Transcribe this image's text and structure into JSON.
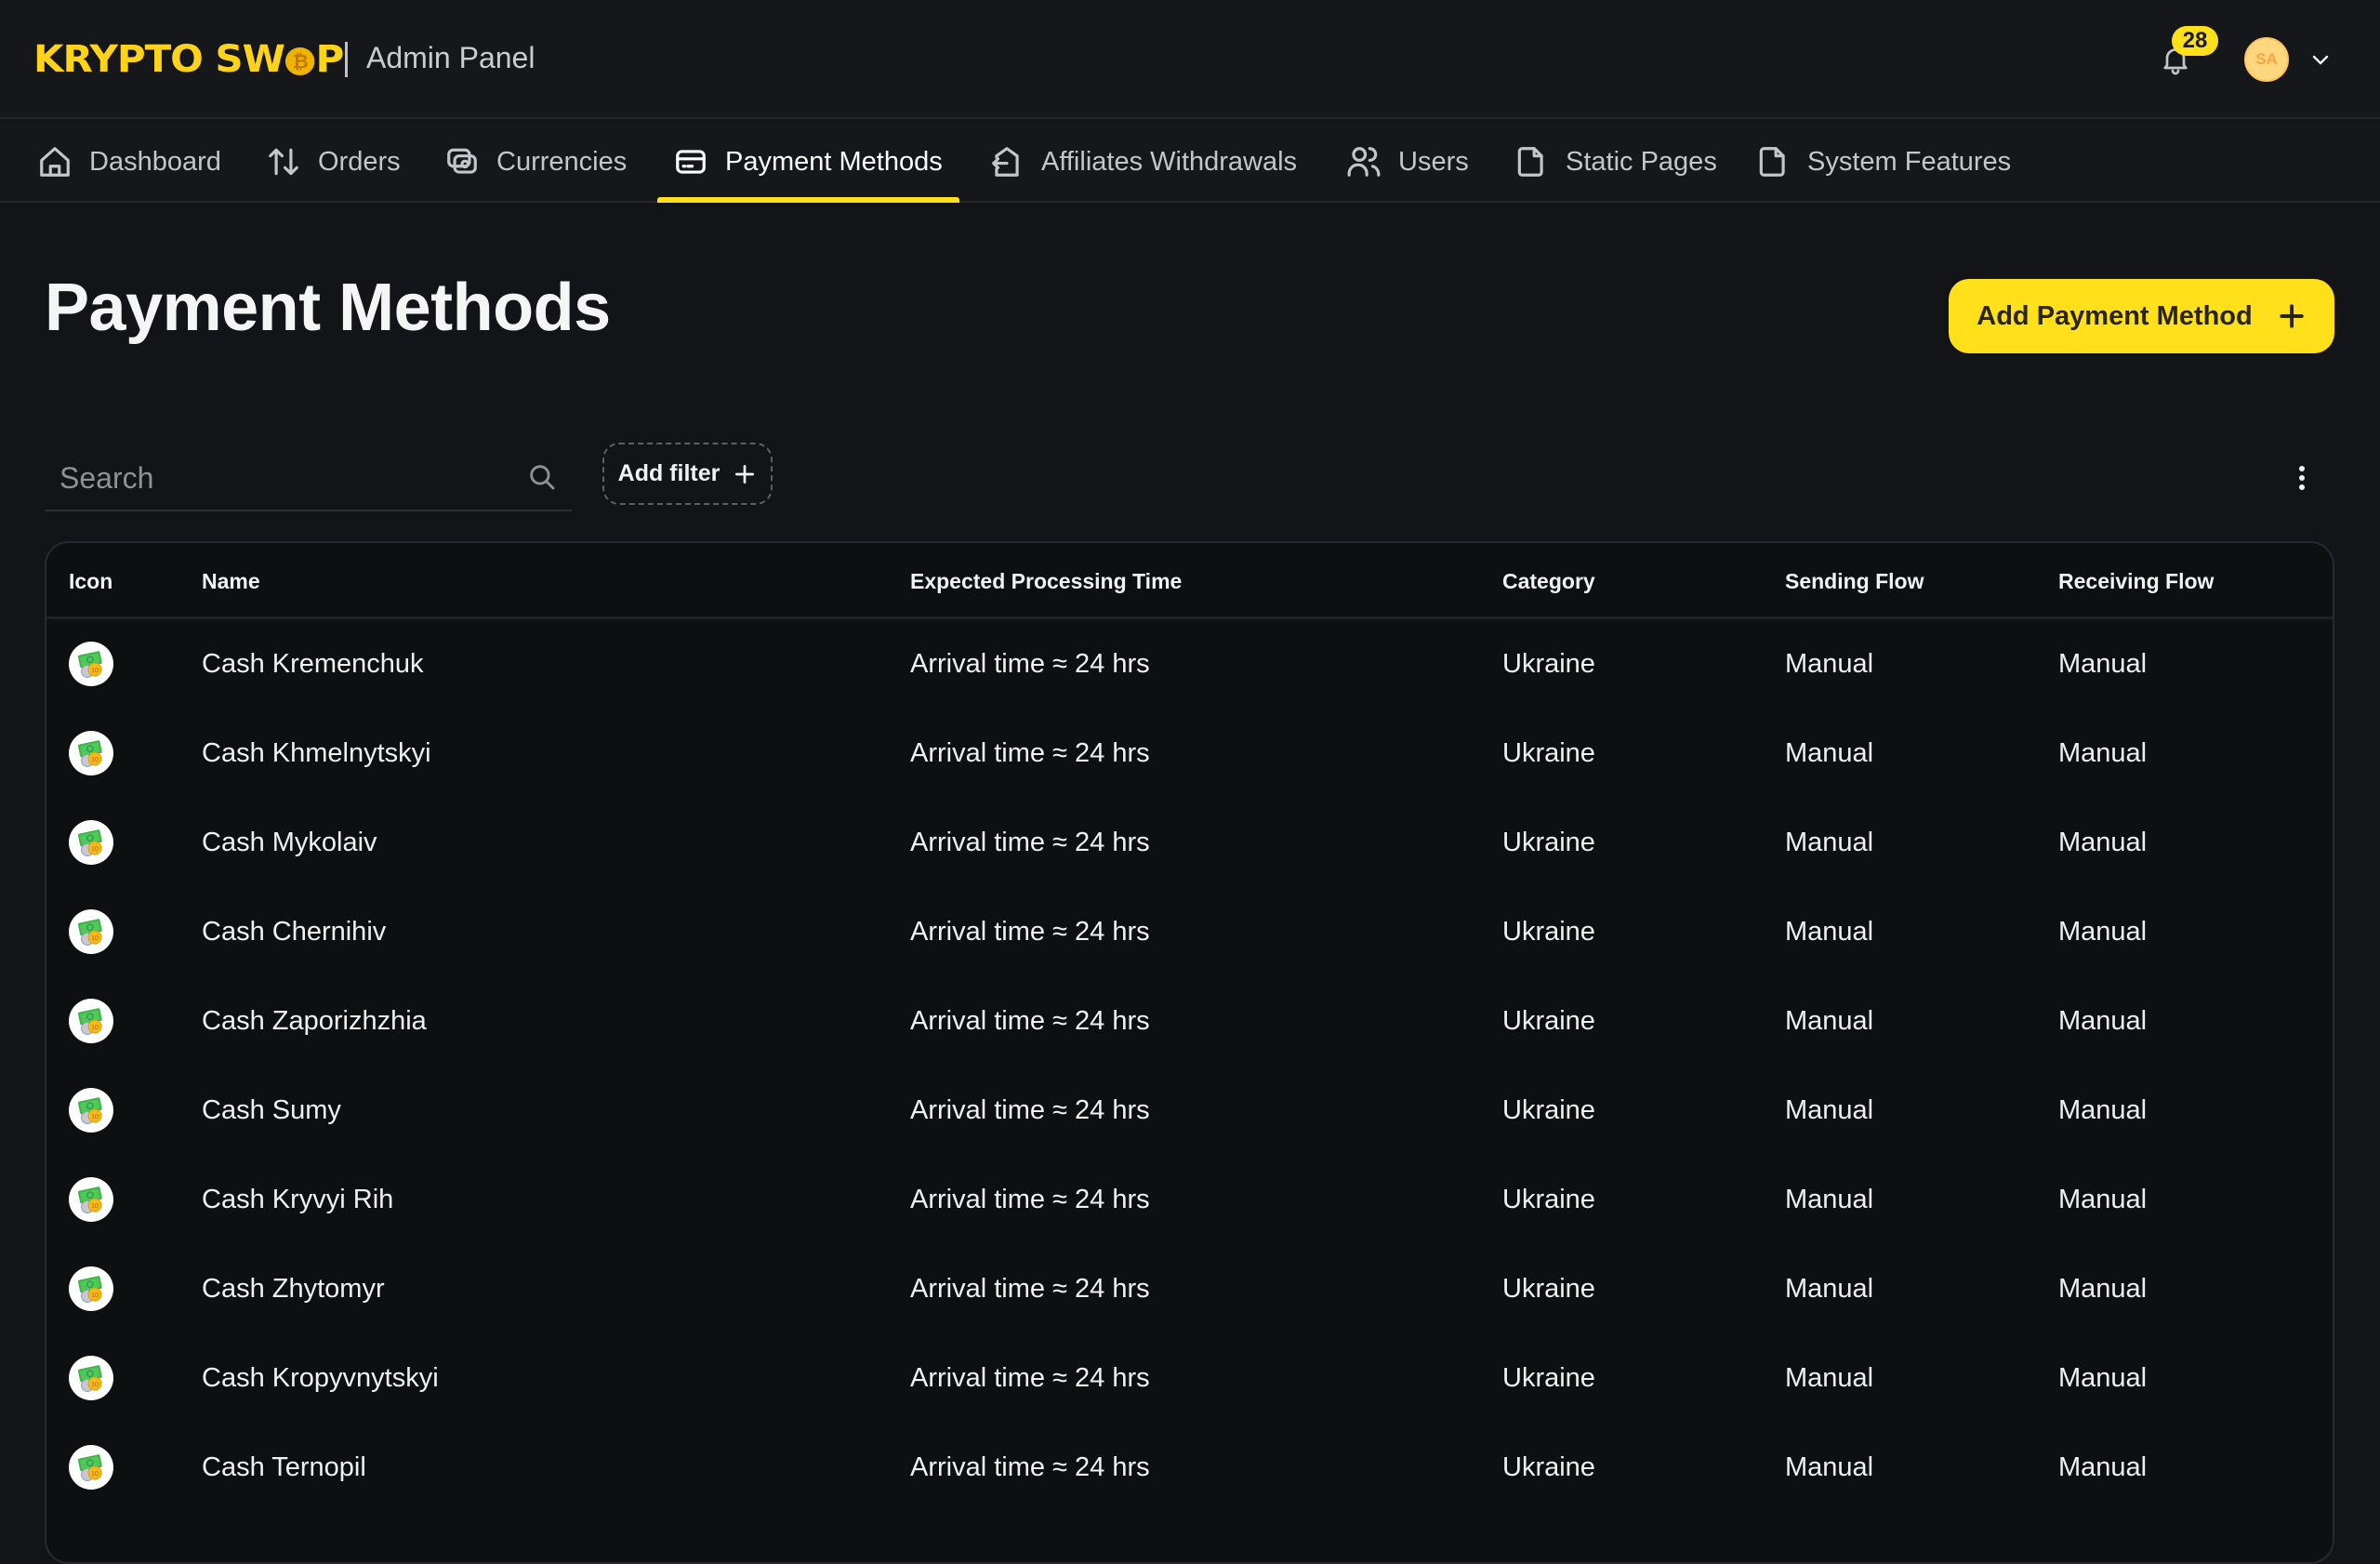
{
  "brand": {
    "logo_text_left": "KRYPTO",
    "logo_text_right_a": "SW",
    "logo_coin": "₿",
    "logo_text_right_b": "P",
    "subtitle": "Admin Panel",
    "accent_color": "#ffe01a"
  },
  "header": {
    "notifications_count": "28",
    "avatar_initials": "SA"
  },
  "nav": {
    "items": [
      {
        "label": "Dashboard",
        "icon": "home-icon"
      },
      {
        "label": "Orders",
        "icon": "arrows-up-down-icon"
      },
      {
        "label": "Currencies",
        "icon": "money-stack-icon"
      },
      {
        "label": "Payment Methods",
        "icon": "credit-card-icon",
        "active": true
      },
      {
        "label": "Affiliates Withdrawals",
        "icon": "withdraw-icon"
      },
      {
        "label": "Users",
        "icon": "users-icon"
      },
      {
        "label": "Static Pages",
        "icon": "document-icon"
      },
      {
        "label": "System Features",
        "icon": "document-icon"
      }
    ]
  },
  "page": {
    "title": "Payment Methods",
    "add_button_label": "Add Payment Method"
  },
  "toolbar": {
    "search_placeholder": "Search",
    "search_value": "",
    "add_filter_label": "Add filter"
  },
  "table": {
    "columns": [
      "Icon",
      "Name",
      "Expected Processing Time",
      "Category",
      "Sending Flow",
      "Receiving Flow"
    ],
    "rows": [
      {
        "icon": "cash-icon",
        "name": "Cash Kremenchuk",
        "time": "Arrival time ≈ 24 hrs",
        "category": "Ukraine",
        "sending": "Manual",
        "receiving": "Manual"
      },
      {
        "icon": "cash-icon",
        "name": "Cash Khmelnytskyi",
        "time": "Arrival time ≈ 24 hrs",
        "category": "Ukraine",
        "sending": "Manual",
        "receiving": "Manual"
      },
      {
        "icon": "cash-icon",
        "name": "Cash Mykolaiv",
        "time": "Arrival time ≈ 24 hrs",
        "category": "Ukraine",
        "sending": "Manual",
        "receiving": "Manual"
      },
      {
        "icon": "cash-icon",
        "name": "Cash Chernihiv",
        "time": "Arrival time ≈ 24 hrs",
        "category": "Ukraine",
        "sending": "Manual",
        "receiving": "Manual"
      },
      {
        "icon": "cash-icon",
        "name": "Cash Zaporizhzhia",
        "time": "Arrival time ≈ 24 hrs",
        "category": "Ukraine",
        "sending": "Manual",
        "receiving": "Manual"
      },
      {
        "icon": "cash-icon",
        "name": "Cash Sumy",
        "time": "Arrival time ≈ 24 hrs",
        "category": "Ukraine",
        "sending": "Manual",
        "receiving": "Manual"
      },
      {
        "icon": "cash-icon",
        "name": "Cash Kryvyi Rih",
        "time": "Arrival time ≈ 24 hrs",
        "category": "Ukraine",
        "sending": "Manual",
        "receiving": "Manual"
      },
      {
        "icon": "cash-icon",
        "name": "Cash Zhytomyr",
        "time": "Arrival time ≈ 24 hrs",
        "category": "Ukraine",
        "sending": "Manual",
        "receiving": "Manual"
      },
      {
        "icon": "cash-icon",
        "name": "Cash Kropyvnytskyi",
        "time": "Arrival time ≈ 24 hrs",
        "category": "Ukraine",
        "sending": "Manual",
        "receiving": "Manual"
      },
      {
        "icon": "cash-icon",
        "name": "Cash Ternopil",
        "time": "Arrival time ≈ 24 hrs",
        "category": "Ukraine",
        "sending": "Manual",
        "receiving": "Manual"
      }
    ]
  }
}
